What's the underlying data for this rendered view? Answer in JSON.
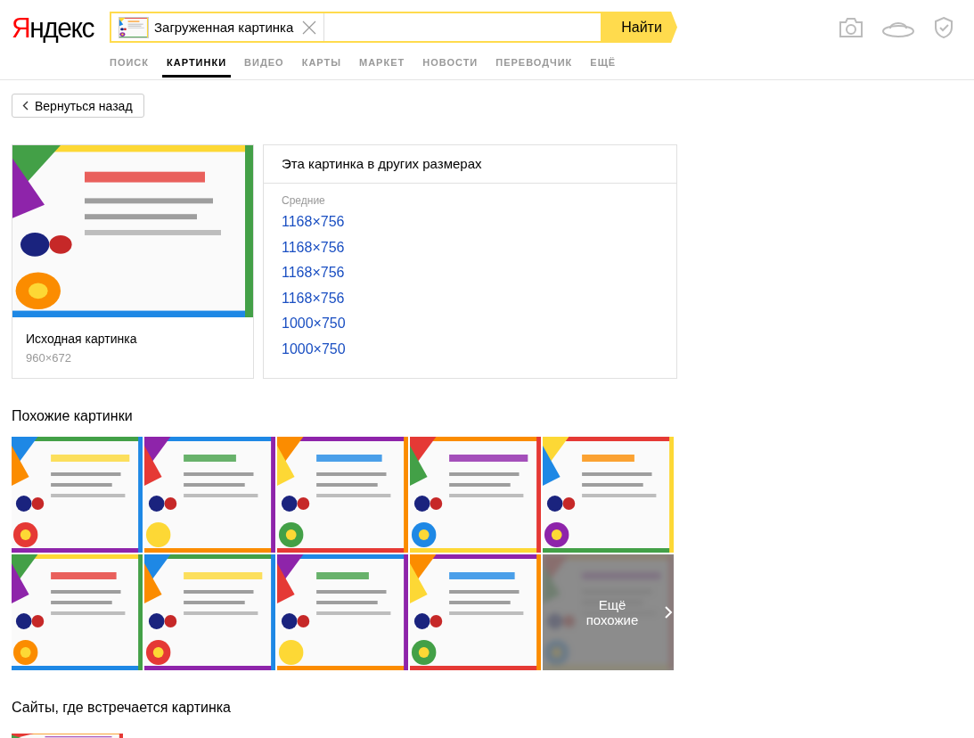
{
  "logo": "Яндекс",
  "search": {
    "value": "Загруженная картинка",
    "button": "Найти"
  },
  "tabs": [
    {
      "label": "ПОИСК",
      "selected": false
    },
    {
      "label": "КАРТИНКИ",
      "selected": true
    },
    {
      "label": "ВИДЕО",
      "selected": false
    },
    {
      "label": "КАРТЫ",
      "selected": false
    },
    {
      "label": "МАРКЕТ",
      "selected": false
    },
    {
      "label": "НОВОСТИ",
      "selected": false
    },
    {
      "label": "ПЕРЕВОДЧИК",
      "selected": false
    },
    {
      "label": "ЕЩЁ",
      "selected": false
    }
  ],
  "back_button": "Вернуться назад",
  "original": {
    "title": "Исходная картинка",
    "size": "960×672"
  },
  "sizes_panel": {
    "title": "Эта картинка в других размерах",
    "group": "Средние",
    "links": [
      "1168×756",
      "1168×756",
      "1168×756",
      "1168×756",
      "1000×750",
      "1000×750"
    ]
  },
  "similar": {
    "title": "Похожие картинки",
    "rows": [
      {
        "tiles": [
          {
            "kind": "picture"
          },
          {
            "kind": "picture"
          },
          {
            "kind": "picture"
          },
          {
            "kind": "picture"
          },
          {
            "kind": "picture"
          }
        ]
      },
      {
        "tiles": [
          {
            "kind": "picture"
          },
          {
            "kind": "picture"
          },
          {
            "kind": "picture"
          },
          {
            "kind": "picture"
          },
          {
            "kind": "more",
            "label": "Ещё похожие"
          }
        ]
      }
    ]
  },
  "sites": {
    "title": "Сайты, где встречается картинка"
  }
}
